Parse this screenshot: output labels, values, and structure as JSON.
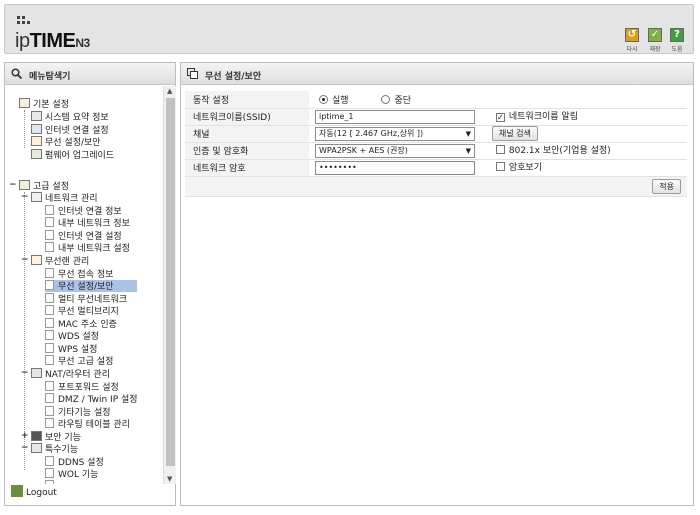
{
  "header": {
    "brand_prefix": "ip",
    "brand_bold": "TIME",
    "brand_model": "N3",
    "buttons": [
      {
        "label": "다시",
        "color": "#d6a21c",
        "glyph": "↺"
      },
      {
        "label": "재장",
        "color": "#7cb342",
        "glyph": "✓"
      },
      {
        "label": "도움",
        "color": "#3f9f3f",
        "glyph": "?"
      }
    ]
  },
  "menu": {
    "title": "메뉴탐색기",
    "basic": {
      "label": "기본 설정",
      "items": [
        "시스템 요약 정보",
        "인터넷 연결 설정",
        "무선 설정/보안",
        "펌웨어 업그레이드"
      ]
    },
    "advanced": {
      "label": "고급 설정",
      "network": {
        "label": "네트워크 관리",
        "items": [
          "인터넷 연결 정보",
          "내부 네트워크 정보",
          "인터넷 연결 설정",
          "내부 네트워크 설정"
        ]
      },
      "wireless": {
        "label": "무선랜 관리",
        "items": [
          "무선 접속 정보",
          "무선 설정/보안",
          "멀티 무선네트워크",
          "무선 멀티브리지",
          "MAC 주소 인증",
          "WDS 설정",
          "WPS 설정",
          "무선 고급 설정"
        ]
      },
      "nat": {
        "label": "NAT/라우터 관리",
        "items": [
          "포트포워드 설정",
          "DMZ / Twin IP 설정",
          "기타기능 설정",
          "라우팅 테이블 관리"
        ]
      },
      "security": {
        "label": "보안 기능"
      },
      "special": {
        "label": "특수기능",
        "items": [
          "DDNS 설정",
          "WOL 기능"
        ]
      }
    },
    "logout": "Logout"
  },
  "form": {
    "title": "무선 설정/보안",
    "rows": {
      "operation": {
        "label": "동작 설정",
        "on": "실행",
        "off": "중단"
      },
      "ssid": {
        "label": "네트워크이름(SSID)",
        "value": "iptime_1",
        "broadcast_label": "네트워크이름 알림"
      },
      "channel": {
        "label": "채널",
        "value": "자동(12 [ 2.467 GHz,상위 ])",
        "search_button": "채널 검색"
      },
      "auth": {
        "label": "인증 및 암호화",
        "value": "WPA2PSK + AES (권장)",
        "enterprise_label": "802.1x 보안(기업용 설정)"
      },
      "password": {
        "label": "네트워크 암호",
        "value": "••••••••",
        "show_label": "암호보기"
      }
    },
    "apply_button": "적용"
  }
}
